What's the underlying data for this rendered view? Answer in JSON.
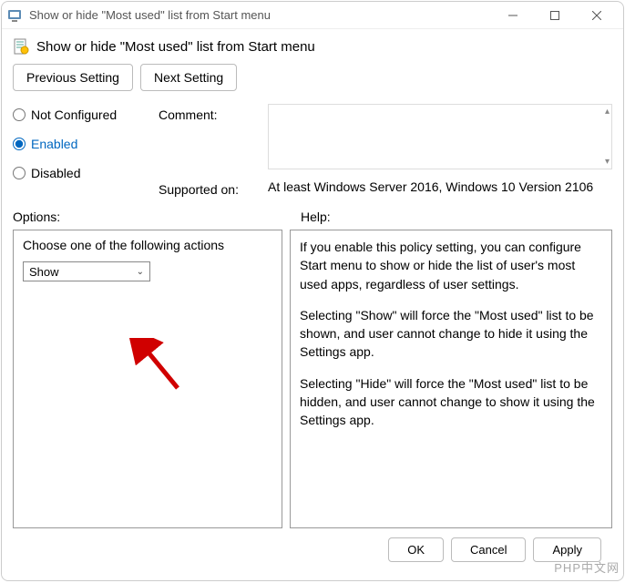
{
  "window": {
    "title": "Show or hide \"Most used\" list from Start menu"
  },
  "header": {
    "title": "Show or hide \"Most used\" list from Start menu"
  },
  "nav": {
    "previous": "Previous Setting",
    "next": "Next Setting"
  },
  "radio": {
    "not_configured": "Not Configured",
    "enabled": "Enabled",
    "disabled": "Disabled",
    "selected": "enabled"
  },
  "labels": {
    "comment": "Comment:",
    "supported_on": "Supported on:",
    "options": "Options:",
    "help": "Help:"
  },
  "supported_text": "At least Windows Server 2016, Windows 10 Version 2106",
  "options": {
    "action_label": "Choose one of the following actions",
    "dropdown_value": "Show"
  },
  "help": {
    "p1": "If you enable this policy setting, you can configure Start menu to show or hide the list of user's most used apps, regardless of user settings.",
    "p2": "Selecting \"Show\" will force the \"Most used\" list to be shown, and user cannot change to hide it using the Settings app.",
    "p3": "Selecting \"Hide\" will force the \"Most used\" list to be hidden, and user cannot change to show it using the Settings app."
  },
  "footer": {
    "ok": "OK",
    "cancel": "Cancel",
    "apply": "Apply"
  },
  "watermark": "PHP中文网"
}
